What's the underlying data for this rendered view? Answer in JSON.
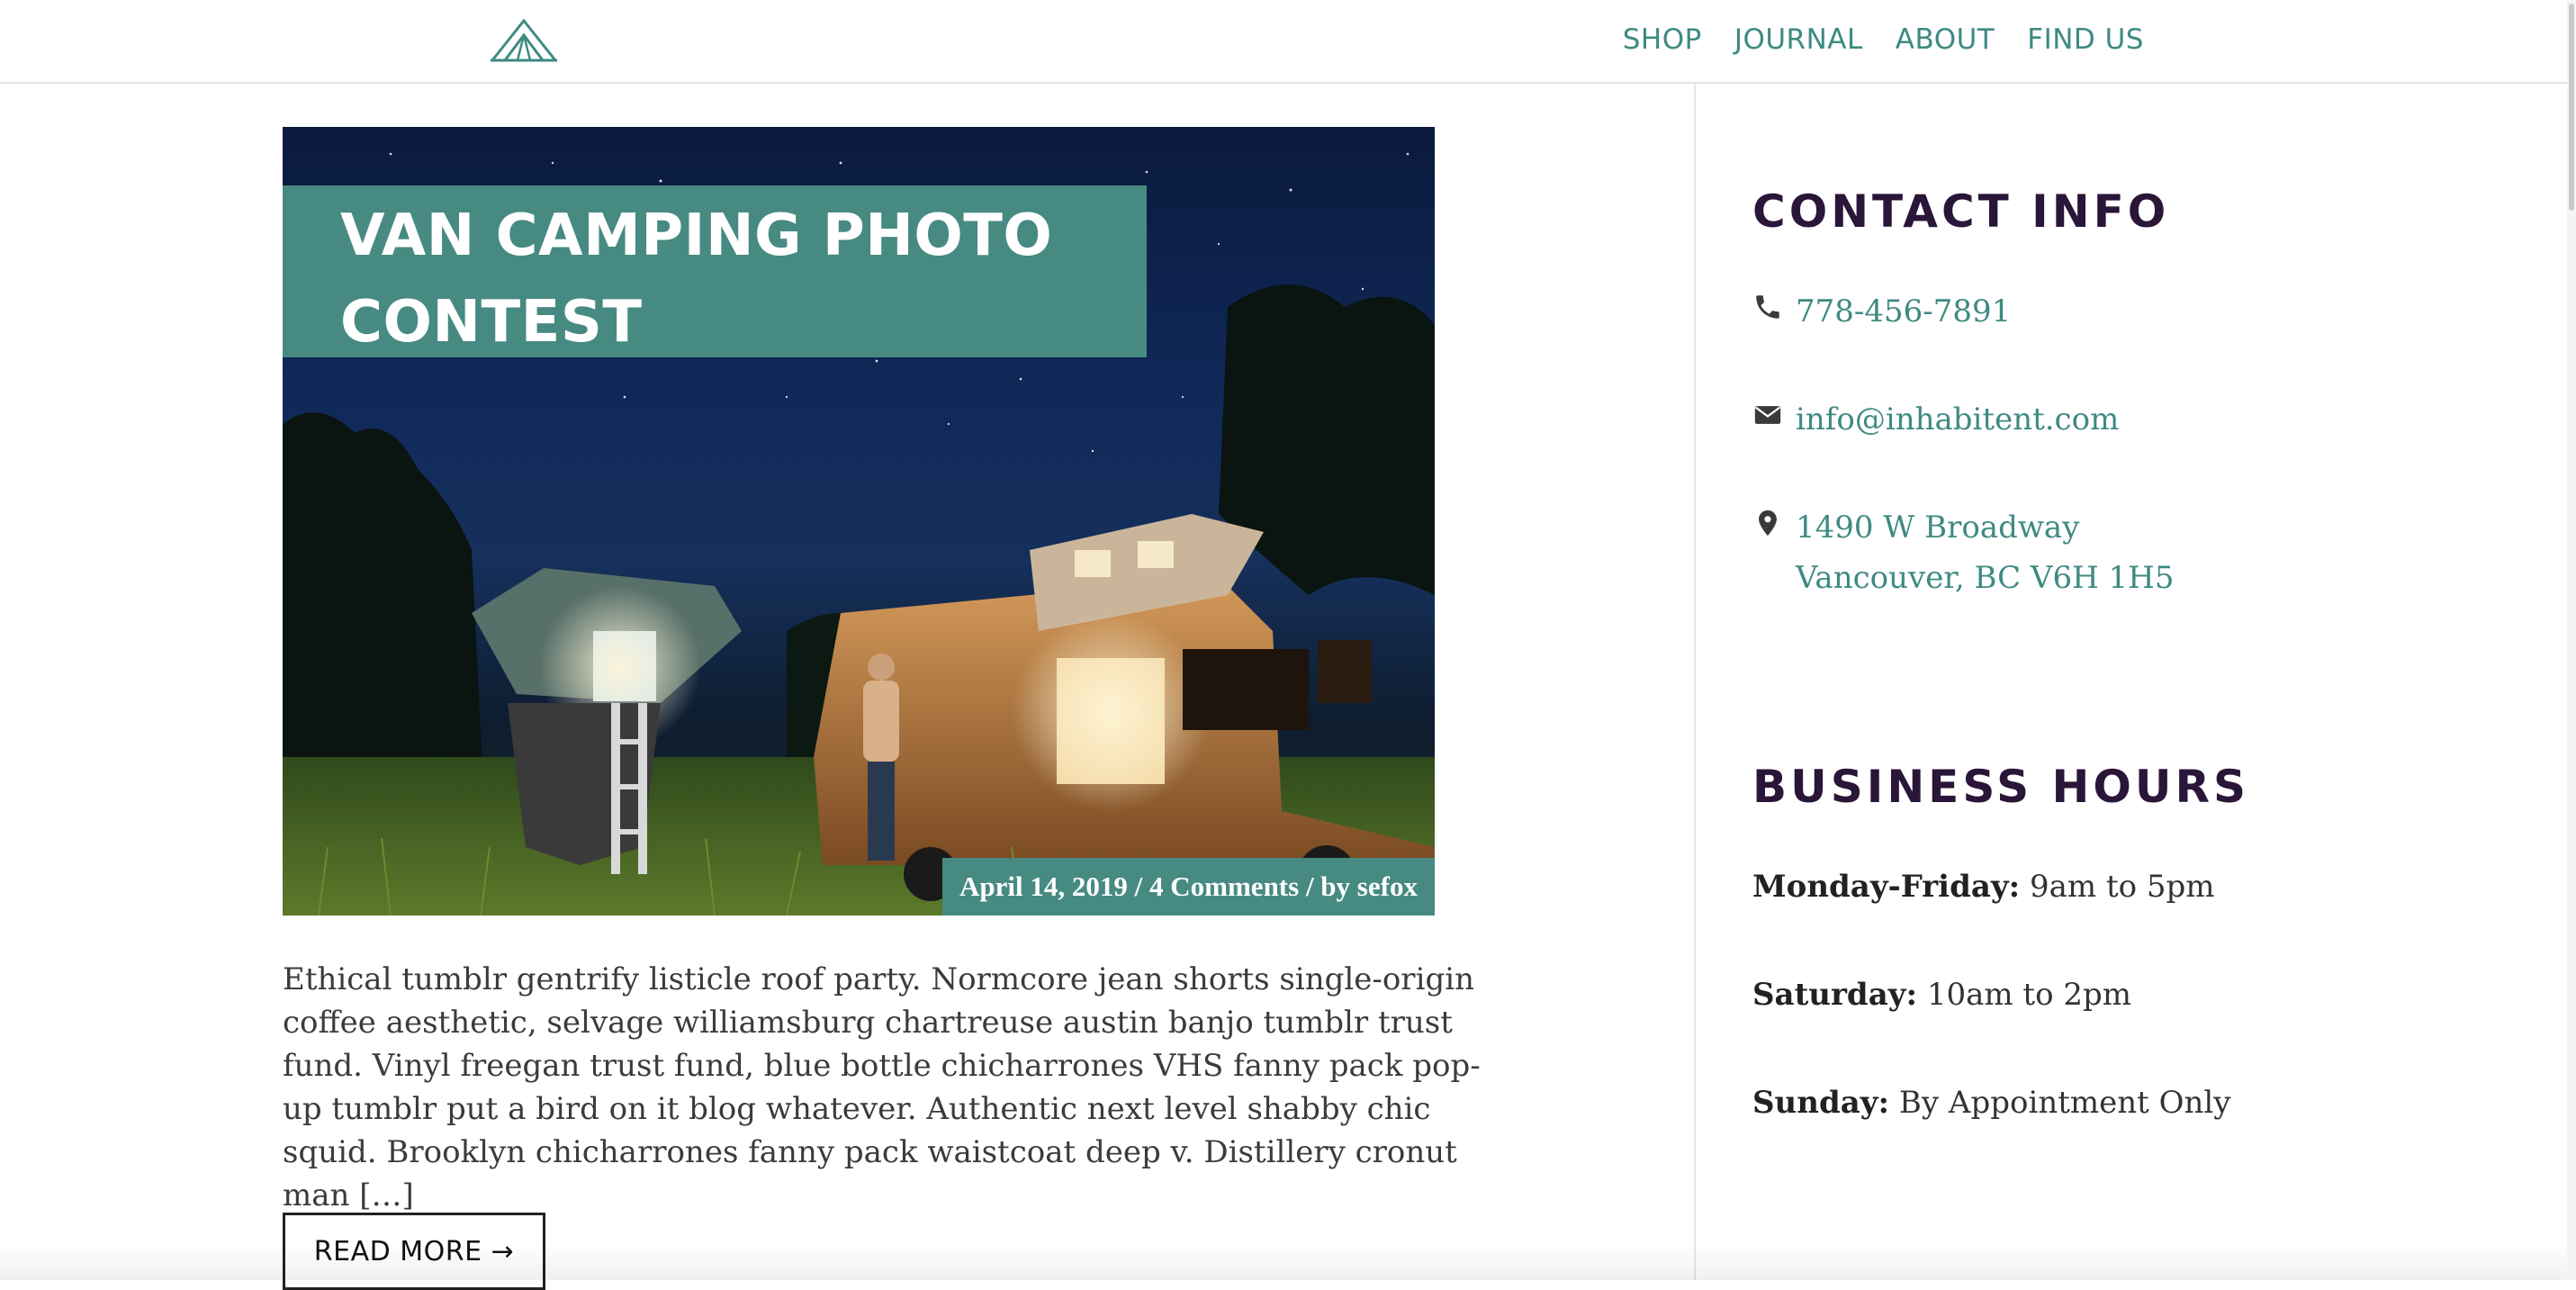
{
  "header": {
    "logo_name": "tent-logo",
    "nav": [
      {
        "label": "SHOP"
      },
      {
        "label": "JOURNAL"
      },
      {
        "label": "ABOUT"
      },
      {
        "label": "FIND US"
      }
    ]
  },
  "post": {
    "title": "VAN CAMPING PHOTO CONTEST",
    "meta": "April 14, 2019 / 4 Comments / by sefox",
    "excerpt": "Ethical tumblr gentrify listicle roof party. Normcore jean shorts single-origin coffee aesthetic, selvage williamsburg chartreuse austin banjo tumblr trust fund. Vinyl freegan trust fund, blue bottle chicharrones VHS fanny pack pop-up tumblr put a bird on it blog whatever. Authentic next level shabby chic squid. Brooklyn chicharrones fanny pack waistcoat deep v. Distillery cronut man […]",
    "read_more": "READ MORE →"
  },
  "sidebar": {
    "contact_heading": "CONTACT INFO",
    "phone": "778-456-7891",
    "email": "info@inhabitent.com",
    "address_line1": "1490 W Broadway",
    "address_line2": "Vancouver, BC V6H 1H5",
    "hours_heading": "BUSINESS HOURS",
    "hours": [
      {
        "day": "Monday-Friday:",
        "time": " 9am to 5pm"
      },
      {
        "day": "Saturday:",
        "time": " 10am to 2pm"
      },
      {
        "day": "Sunday:",
        "time": " By Appointment Only"
      }
    ]
  },
  "colors": {
    "accent": "#478a82",
    "link": "#3e8a82",
    "heading": "#2a1638"
  }
}
